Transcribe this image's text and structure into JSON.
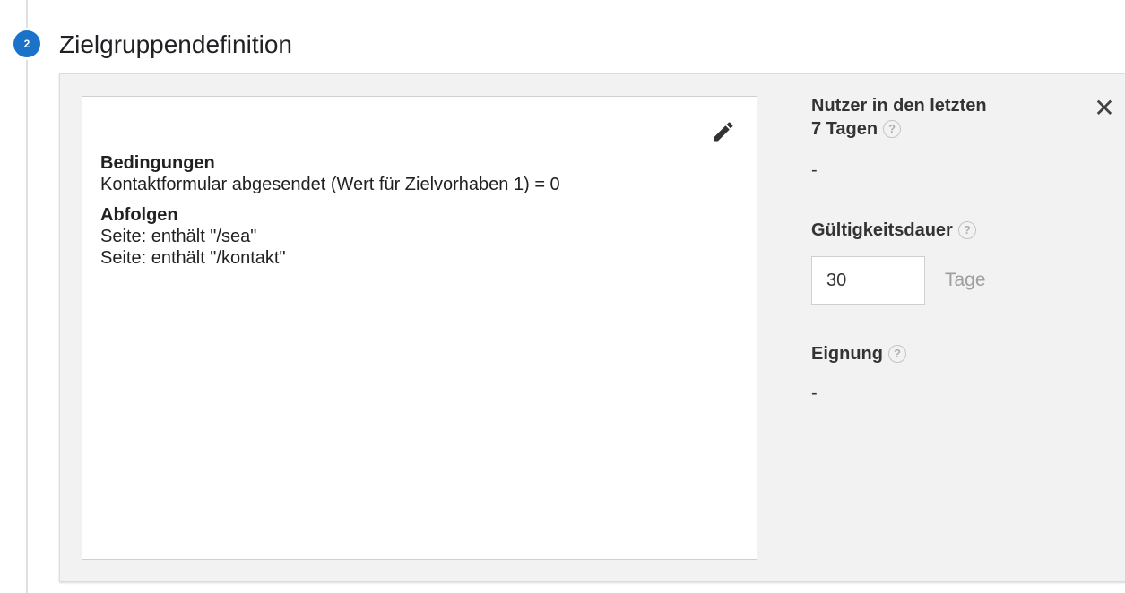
{
  "step": {
    "number": "2",
    "title": "Zielgruppendefinition",
    "accent_color": "#1a73c8"
  },
  "definition": {
    "edit_icon": "pencil-icon",
    "conditions_heading": "Bedingungen",
    "conditions": [
      "Kontaktformular abgesendet (Wert für Zielvorhaben 1) = 0"
    ],
    "sequences_heading": "Abfolgen",
    "sequences": [
      "Seite: enthält \"/sea\"",
      "Seite: enthält \"/kontakt\""
    ]
  },
  "sidebar": {
    "users_label_line1": "Nutzer in den letzten",
    "users_label_line2": "7 Tagen",
    "users_value": "-",
    "validity_label": "Gültigkeitsdauer",
    "validity_value": "30",
    "validity_unit": "Tage",
    "eligibility_label": "Eignung",
    "eligibility_value": "-",
    "help_symbol": "?",
    "close_symbol": "✕"
  }
}
